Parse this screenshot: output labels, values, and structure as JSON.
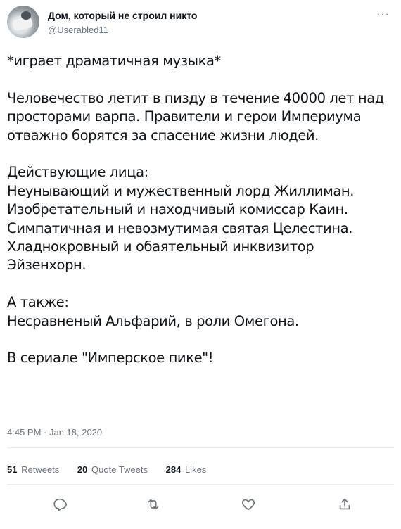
{
  "tweet": {
    "author_name": "Дом, который не строил никто",
    "author_handle": "@Userabled11",
    "more_label": "···",
    "lines": [
      "*играет драматичная музыка*",
      "",
      "Человечество летит в пизду в течение 40000 лет над",
      "просторами варпа. Правители и герои Империума",
      "отважно борятся за спасение жизни людей.",
      "",
      "Действующие лица:",
      "Неунывающий и мужественный лорд Жиллиман.",
      "Изобретательный и находчивый комиссар Каин.",
      "Симпатичная и невозмутимая святая Целестина.",
      "Хладнокровный и обаятельный инквизитор",
      "Эйзенхорн.",
      "",
      "А также:",
      "Несравненый Альфарий, в роли Омегона.",
      "",
      "В сериале \"Имперское пике\"!"
    ],
    "timestamp": "4:45 PM · Jan 18, 2020",
    "stats": {
      "retweets_count": "51",
      "retweets_label": "Retweets",
      "quotes_count": "20",
      "quotes_label": "Quote Tweets",
      "likes_count": "284",
      "likes_label": "Likes"
    },
    "actions": [
      "reply-icon",
      "retweet-icon",
      "like-icon",
      "share-icon"
    ],
    "colors": {
      "text": "#0f1419",
      "secondary": "#6e767d",
      "divider": "#e6ecf0"
    }
  }
}
